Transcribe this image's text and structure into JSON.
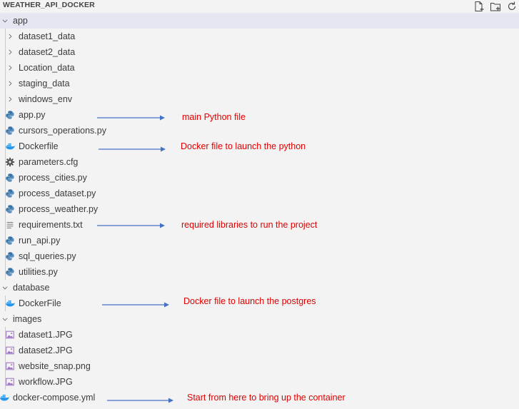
{
  "explorer": {
    "title": "WEATHER_API_DOCKER",
    "actions": [
      "new-file-icon",
      "new-folder-icon",
      "refresh-icon"
    ]
  },
  "tree": {
    "app": {
      "label": "app",
      "folders": [
        "dataset1_data",
        "dataset2_data",
        "Location_data",
        "staging_data",
        "windows_env"
      ],
      "files": [
        "app.py",
        "cursors_operations.py",
        "Dockerfile",
        "parameters.cfg",
        "process_cities.py",
        "process_dataset.py",
        "process_weather.py",
        "requirements.txt",
        "run_api.py",
        "sql_queries.py",
        "utilities.py"
      ]
    },
    "database": {
      "label": "database",
      "files": [
        "DockerFile"
      ]
    },
    "images": {
      "label": "images",
      "files": [
        "dataset1.JPG",
        "dataset2.JPG",
        "website_snap.png",
        "workflow.JPG"
      ]
    },
    "root_files": [
      "docker-compose.yml"
    ]
  },
  "annotations": [
    "main Python file",
    "Docker file to launch the python",
    "required libraries to run the project",
    "Docker file to launch the postgres",
    "Start from here to bring up the container"
  ],
  "colors": {
    "background": "#f3f3f3",
    "selected_row": "#e4e6f1",
    "annotation_text": "#e00000",
    "arrow": "#4472c4",
    "python_icon": "#3572a5",
    "docker_icon": "#2496ed",
    "image_icon": "#a074c4"
  }
}
